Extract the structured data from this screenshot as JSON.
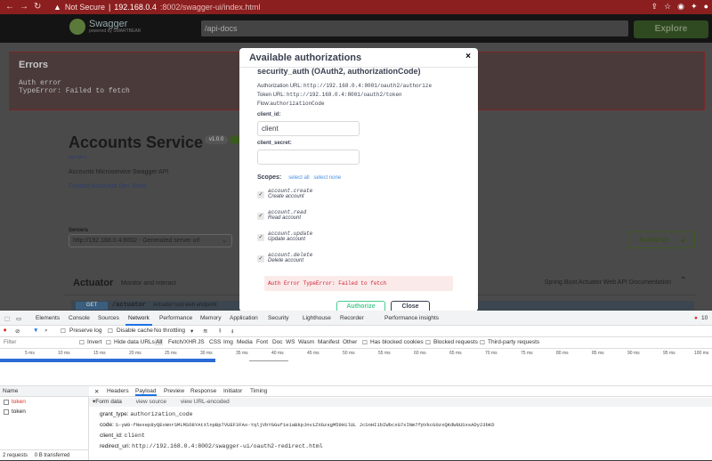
{
  "browser": {
    "not_secure": "Not Secure",
    "url_host": "192.168.0.4",
    "url_path": ":8002/swagger-ui/index.html"
  },
  "swagger": {
    "logo_name": "Swagger",
    "logo_sub": "powered by SMARTBEAR",
    "api_docs": "/api-docs",
    "explore_label": "Explore",
    "errors_title": "Errors",
    "error_line1": "Auth error",
    "error_line2": "TypeError: Failed to fetch",
    "service_title": "Accounts Service",
    "version": "v1.0.0",
    "docs_link": "/api-docs",
    "description": "Accounts Microservice Swagger API",
    "contact": "Contact Accounts Dev Team",
    "servers_label": "Servers",
    "server_selected": "http://192.168.0.4:8002 - Generated server url",
    "authorize_label": "Authorize",
    "actuator_title": "Actuator",
    "actuator_desc": "Monitor and interact",
    "actuator_right": "Spring Boot Actuator Web API Documentation",
    "get_method": "GET",
    "get_path": "/actuator",
    "get_desc": "Actuator root web endpoint"
  },
  "modal": {
    "title": "Available authorizations",
    "close_x": "×",
    "section": "security_auth (OAuth2, authorizationCode)",
    "auth_url_label": "Authorization URL:",
    "auth_url": "http://192.168.0.4:8001/oauth2/authorize",
    "token_url_label": "Token URL:",
    "token_url": "http://192.168.0.4:8001/oauth2/token",
    "flow_label": "Flow:",
    "flow": "authorizationCode",
    "client_id_label": "client_id:",
    "client_id_value": "client",
    "client_secret_label": "client_secret:",
    "client_secret_value": "",
    "scopes_label": "Scopes:",
    "select_all": "select all",
    "select_none": "select none",
    "scopes": [
      {
        "name": "account.create",
        "desc": "Create account"
      },
      {
        "name": "account.read",
        "desc": "Read account"
      },
      {
        "name": "account.update",
        "desc": "Update account"
      },
      {
        "name": "account.delete",
        "desc": "Delete account"
      }
    ],
    "error": "Auth Error  TypeError: Failed to fetch",
    "authorize_label": "Authorize",
    "close_label": "Close"
  },
  "devtools": {
    "tabs": [
      "Elements",
      "Console",
      "Sources",
      "Network",
      "Performance",
      "Memory",
      "Application",
      "Security",
      "Lighthouse",
      "Recorder",
      "Performance insights"
    ],
    "issue_count": "10",
    "preserve_log": "Preserve log",
    "disable_cache": "Disable cache",
    "throttling": "No throttling",
    "filter_placeholder": "Filter",
    "filter_items": [
      "Invert",
      "Hide data URLs",
      "All",
      "Fetch/XHR",
      "JS",
      "CSS",
      "Img",
      "Media",
      "Font",
      "Doc",
      "WS",
      "Wasm",
      "Manifest",
      "Other",
      "Has blocked cookies",
      "Blocked requests",
      "Third-party requests"
    ],
    "ticks": [
      "5 ms",
      "10 ms",
      "15 ms",
      "20 ms",
      "25 ms",
      "30 ms",
      "35 ms",
      "40 ms",
      "45 ms",
      "50 ms",
      "55 ms",
      "60 ms",
      "65 ms",
      "70 ms",
      "75 ms",
      "80 ms",
      "85 ms",
      "90 ms",
      "95 ms",
      "100 ms"
    ],
    "name_header": "Name",
    "requests": [
      "token",
      "token"
    ],
    "footer": "2 requests",
    "footer2": "0 B transferred",
    "detail_tabs": [
      "Headers",
      "Payload",
      "Preview",
      "Response",
      "Initiator",
      "Timing"
    ],
    "form_data": "▾Form data",
    "view_source": "view source",
    "view_url": "view URL-encoded",
    "payload": [
      {
        "k": "grant_type:",
        "v": "authorization_code"
      },
      {
        "k": "code:",
        "v": "S-yW9-fNexep8yQEvWnrSMLMSO8YAtXlnpBp7VUEF3FAo-YqljVbYGGuf1e1aBkpJnviZXGzsgM59H1lUL JcSnHI1bIWbcxG7xINm7fpVkcG0zxQKdW8USxsADy23bKD"
      },
      {
        "k": "client_id:",
        "v": "client"
      },
      {
        "k": "redirect_uri:",
        "v": "http://192.168.0.4:8002/swagger-ui/oauth2-redirect.html"
      }
    ]
  }
}
